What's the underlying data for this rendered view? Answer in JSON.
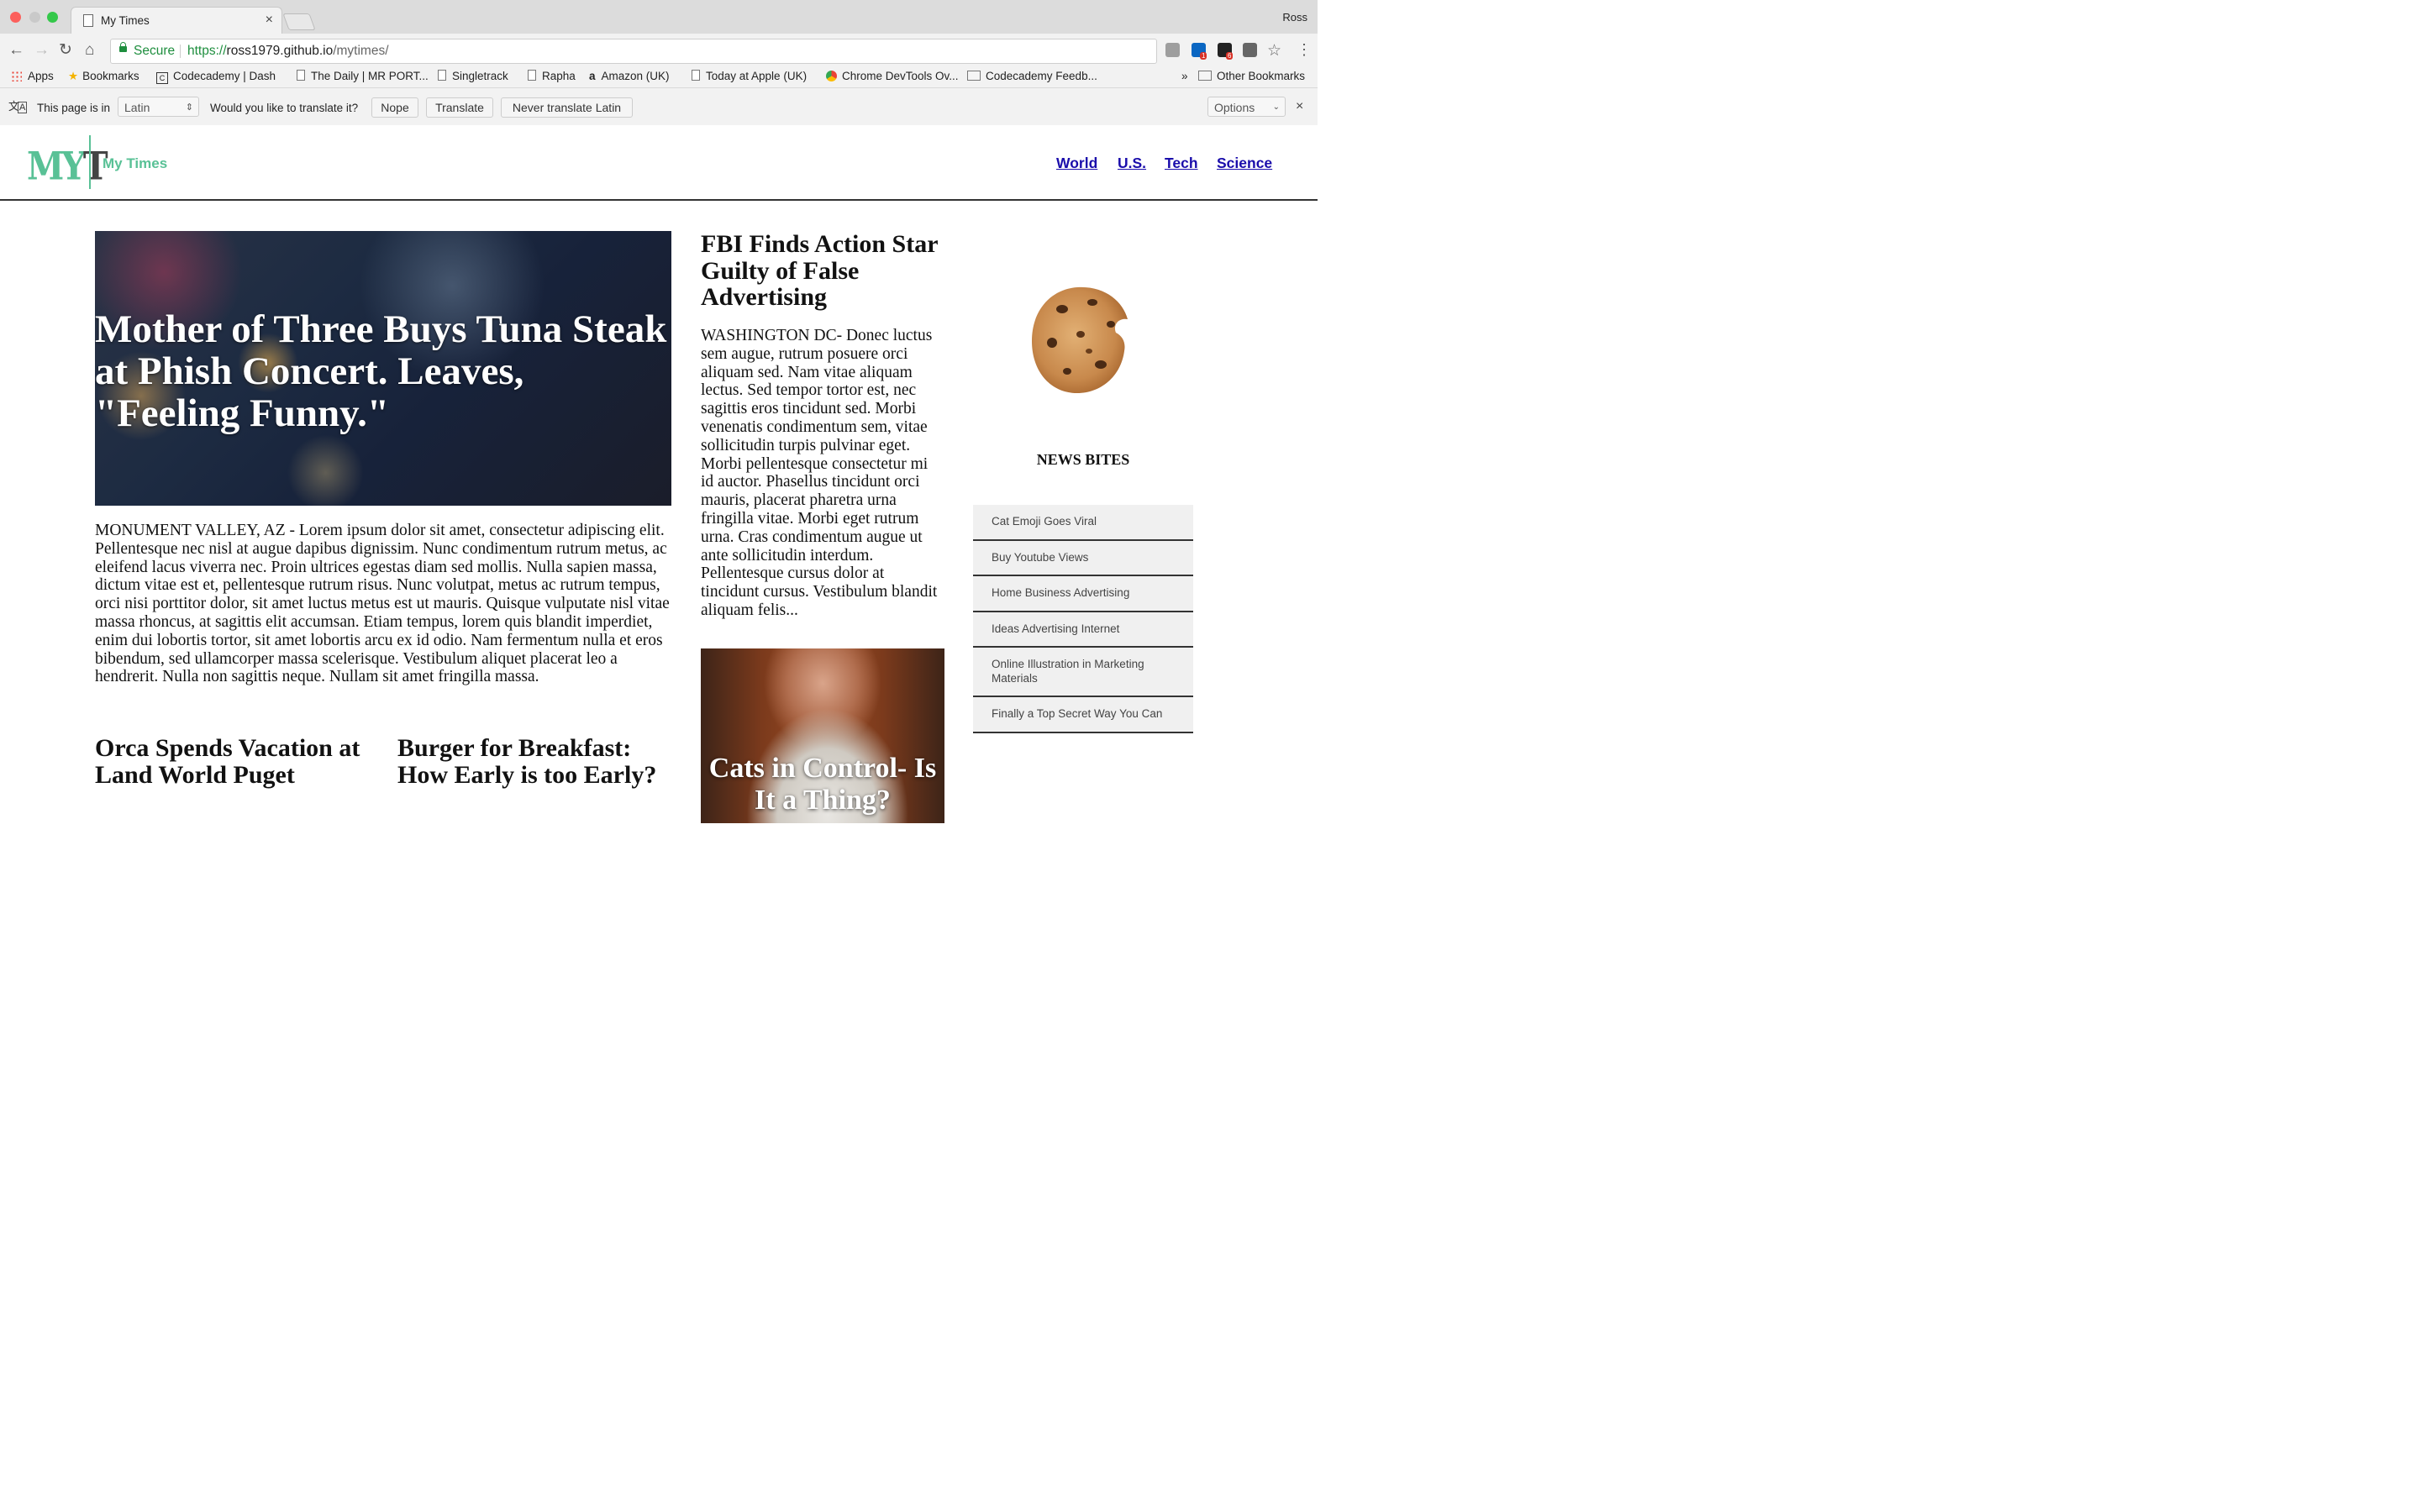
{
  "browser": {
    "tab_title": "My Times",
    "user_name": "Ross",
    "secure_label": "Secure",
    "url_scheme": "https://",
    "url_host": "ross1979.github.io",
    "url_path": "/mytimes/",
    "bookmarks": [
      {
        "label": "Apps",
        "icon": "apps-grid-icon"
      },
      {
        "label": "Bookmarks",
        "icon": "star-icon"
      },
      {
        "label": "Codecademy | Dash",
        "icon": "codecademy-icon"
      },
      {
        "label": "The Daily | MR PORT...",
        "icon": "page-icon"
      },
      {
        "label": "Singletrack",
        "icon": "page-icon"
      },
      {
        "label": "Rapha",
        "icon": "page-icon"
      },
      {
        "label": "Amazon (UK)",
        "icon": "amazon-icon"
      },
      {
        "label": "Today at Apple (UK)",
        "icon": "page-icon"
      },
      {
        "label": "Chrome DevTools Ov...",
        "icon": "chrome-icon"
      },
      {
        "label": "Codecademy Feedb...",
        "icon": "folder-icon"
      }
    ],
    "overflow_chevron": "»",
    "other_bookmarks": "Other Bookmarks",
    "extension_badges": [
      "1",
      "6"
    ]
  },
  "translate": {
    "page_is_in": "This page is in",
    "language": "Latin",
    "question": "Would you like to translate it?",
    "nope": "Nope",
    "translate": "Translate",
    "never": "Never translate Latin",
    "options": "Options"
  },
  "site": {
    "logo_m": "MY",
    "logo_t": "T",
    "name": "My Times",
    "nav": [
      "World",
      "U.S.",
      "Tech",
      "Science"
    ],
    "accent_color": "#59c196"
  },
  "main": {
    "hero_title": "Mother of Three Buys Tuna Steak at Phish Concert. Leaves, \"Feeling Funny.\"",
    "hero_body": "MONUMENT VALLEY, AZ - Lorem ipsum dolor sit amet, consectetur adipiscing elit. Pellentesque nec nisl at augue dapibus dignissim. Nunc condimentum rutrum metus, ac eleifend lacus viverra nec. Proin ultrices egestas diam sed mollis. Nulla sapien massa, dictum vitae est et, pellentesque rutrum risus. Nunc volutpat, metus ac rutrum tempus, orci nisi porttitor dolor, sit amet luctus metus est ut mauris. Quisque vulputate nisl vitae massa rhoncus, at sagittis elit accumsan. Etiam tempus, lorem quis blandit imperdiet, enim dui lobortis tortor, sit amet lobortis arcu ex id odio. Nam fermentum nulla et eros bibendum, sed ullamcorper massa scelerisque. Vestibulum aliquet placerat leo a hendrerit. Nulla non sagittis neque. Nullam sit amet fringilla massa.",
    "story2_title": "Orca Spends Vacation at Land World Puget",
    "story3_title": "Burger for Breakfast: How Early is too Early?"
  },
  "side": {
    "title": "FBI Finds Action Star Guilty of False Advertising",
    "body": "WASHINGTON DC- Donec luctus sem augue, rutrum posuere orci aliquam sed. Nam vitae aliquam lectus. Sed tempor tortor est, nec sagittis eros tincidunt sed. Morbi venenatis condimentum sem, vitae sollicitudin turpis pulvinar eget. Morbi pellentesque consectetur mi id auctor. Phasellus tincidunt orci mauris, placerat pharetra urna fringilla vitae. Morbi eget rutrum urna. Cras condimentum augue ut ante sollicitudin interdum. Pellentesque cursus dolor at tincidunt cursus. Vestibulum blandit aliquam felis...",
    "cats_title": "Cats in Control- Is It a Thing?"
  },
  "news_bites": {
    "heading": "NEWS BITES",
    "items": [
      "Cat Emoji Goes Viral",
      "Buy Youtube Views",
      "Home Business Advertising",
      "Ideas Advertising Internet",
      "Online Illustration in Marketing Materials",
      "Finally a Top Secret Way You Can"
    ]
  }
}
